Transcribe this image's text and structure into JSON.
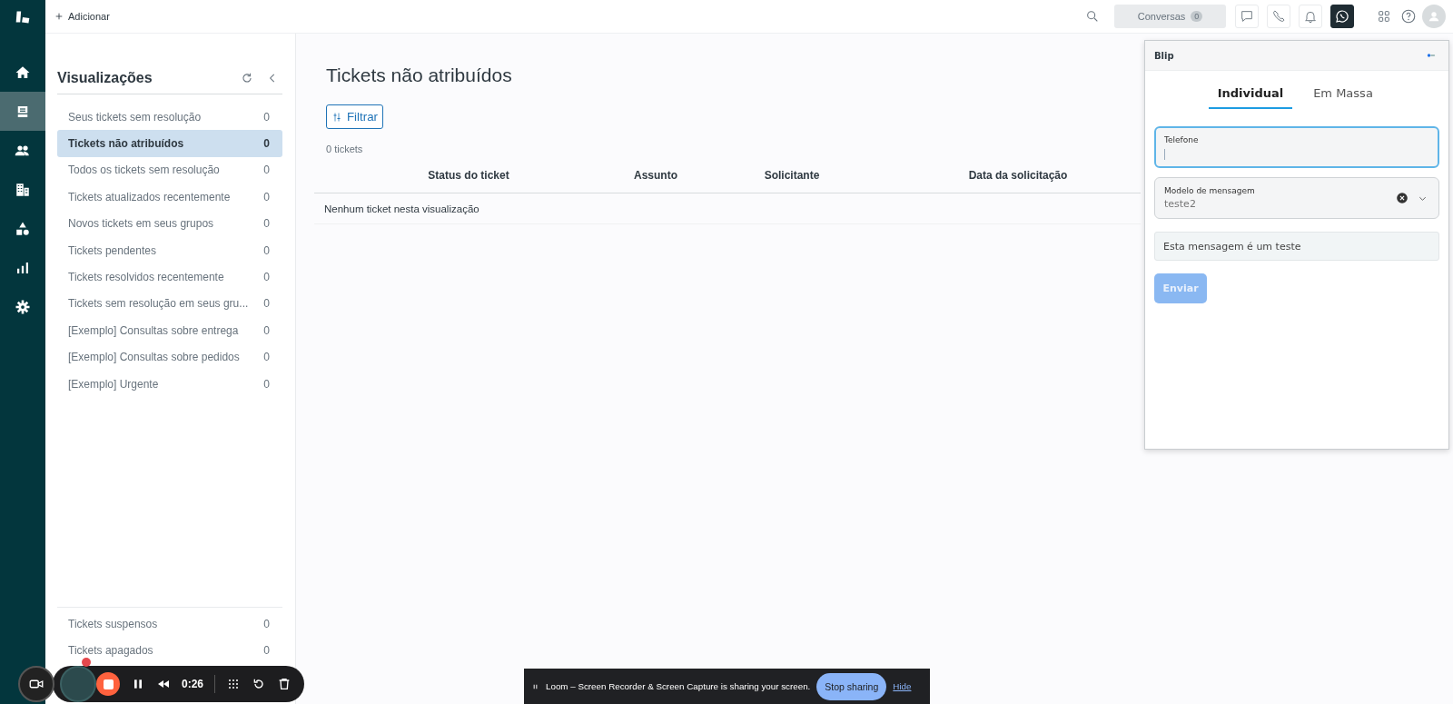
{
  "nav_rail": {
    "items": [
      {
        "kind": "home",
        "selected": false
      },
      {
        "kind": "tickets",
        "selected": true
      },
      {
        "kind": "users",
        "selected": false
      },
      {
        "kind": "buildings",
        "selected": false
      },
      {
        "kind": "shapes",
        "selected": false
      },
      {
        "kind": "reports",
        "selected": false
      },
      {
        "kind": "settings",
        "selected": false
      }
    ]
  },
  "top_bar": {
    "add_label": "Adicionar",
    "conversations": {
      "label": "Conversas",
      "count": "0"
    },
    "tools": [
      {
        "kind": "chat",
        "selected": false
      },
      {
        "kind": "phone",
        "selected": false
      },
      {
        "kind": "bell",
        "selected": false
      },
      {
        "kind": "whatsapp",
        "selected": true
      }
    ]
  },
  "views_panel": {
    "title": "Visualizações",
    "items": [
      {
        "label": "Seus tickets sem resolução",
        "count": "0",
        "selected": false
      },
      {
        "label": "Tickets não atribuídos",
        "count": "0",
        "selected": true
      },
      {
        "label": "Todos os tickets sem resolução",
        "count": "0",
        "selected": false
      },
      {
        "label": "Tickets atualizados recentemente",
        "count": "0",
        "selected": false
      },
      {
        "label": "Novos tickets em seus grupos",
        "count": "0",
        "selected": false
      },
      {
        "label": "Tickets pendentes",
        "count": "0",
        "selected": false
      },
      {
        "label": "Tickets resolvidos recentemente",
        "count": "0",
        "selected": false
      },
      {
        "label": "Tickets sem resolução em seus gru...",
        "count": "0",
        "selected": false
      },
      {
        "label": "[Exemplo] Consultas sobre entrega",
        "count": "0",
        "selected": false
      },
      {
        "label": "[Exemplo] Consultas sobre pedidos",
        "count": "0",
        "selected": false
      },
      {
        "label": "[Exemplo] Urgente",
        "count": "0",
        "selected": false
      }
    ],
    "footer_items": [
      {
        "label": "Tickets suspensos",
        "count": "0",
        "selected": false
      },
      {
        "label": "Tickets apagados",
        "count": "0",
        "selected": false
      }
    ]
  },
  "main": {
    "title": "Tickets não atribuídos",
    "filter_button": "Filtrar",
    "ticket_count": "0 tickets",
    "table": {
      "columns": [
        "Status do ticket",
        "Assunto",
        "Solicitante",
        "Data da solicitação"
      ],
      "empty_message": "Nenhum ticket nesta visualização"
    }
  },
  "blip_panel": {
    "title": "Blip",
    "tabs": [
      {
        "label": "Individual",
        "selected": true
      },
      {
        "label": "Em Massa",
        "selected": false
      }
    ],
    "phone_field": {
      "label": "Telefone",
      "focused": true
    },
    "template_field": {
      "label": "Modelo de mensagem",
      "value": "teste2"
    },
    "message_preview": "Esta mensagem é um teste",
    "send_button": {
      "label": "Enviar",
      "disabled": true
    }
  },
  "loom_controls": {
    "timer": "0:26"
  },
  "share_bar": {
    "message": "Loom – Screen Recorder & Screen Capture is sharing your screen.",
    "stop_button": "Stop sharing",
    "hide_link": "Hide"
  }
}
